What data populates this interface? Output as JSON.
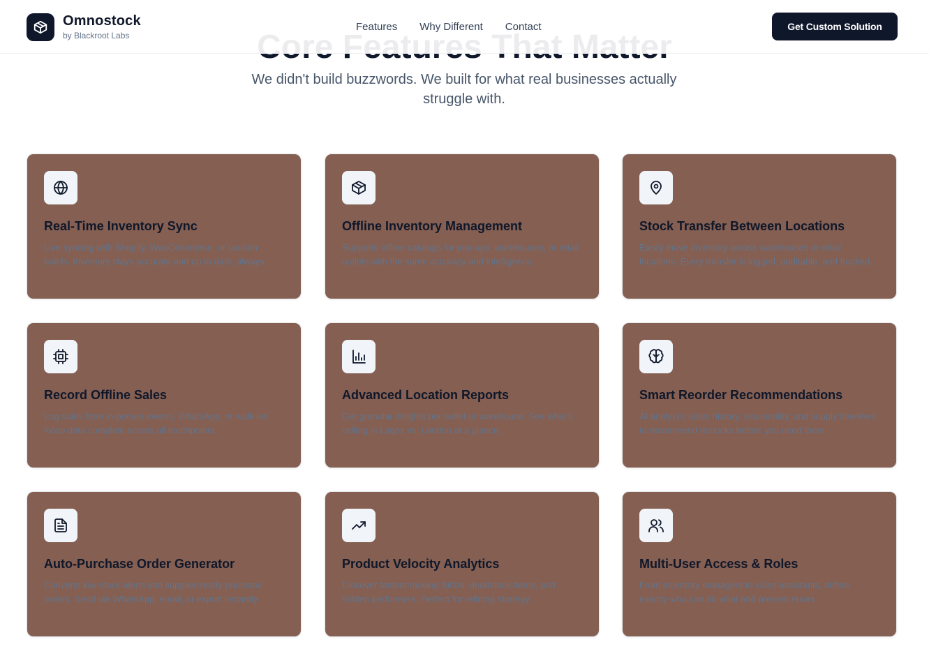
{
  "brand": {
    "name": "Omnostock",
    "sub": "by Blackroot Labs"
  },
  "nav": {
    "items": [
      "Features",
      "Why Different",
      "Contact"
    ]
  },
  "cta": {
    "label": "Get Custom Solution"
  },
  "hero": {
    "title": "Core Features That Matter",
    "subtitle": "We didn't build buzzwords. We built for what real businesses actually struggle with."
  },
  "features": [
    {
      "icon": "globe-icon",
      "title": "Real-Time Inventory Sync",
      "desc": "Live syncing with Shopify, WooCommerce, or custom builds. Inventory stays accurate and up to date, always."
    },
    {
      "icon": "package-icon",
      "title": "Offline Inventory Management",
      "desc": "Supports offline catalogs for pop-ups, warehouses, or retail outlets with the same accuracy and intelligence."
    },
    {
      "icon": "map-pin-icon",
      "title": "Stock Transfer Between Locations",
      "desc": "Easily move inventory across warehouses or retail locations. Every transfer is logged, auditable, and tracked."
    },
    {
      "icon": "cpu-icon",
      "title": "Record Offline Sales",
      "desc": "Log sales from in-person events, WhatsApp, or walk-ins. Keep data complete across all touchpoints."
    },
    {
      "icon": "bar-chart-icon",
      "title": "Advanced Location Reports",
      "desc": "Get granular insights per outlet or warehouse. See what's selling in Lagos vs. London at a glance."
    },
    {
      "icon": "brain-icon",
      "title": "Smart Reorder Recommendations",
      "desc": "AI analyzes sales history, seasonality, and supply timelines to recommend restocks before you need them."
    },
    {
      "icon": "document-icon",
      "title": "Auto-Purchase Order Generator",
      "desc": "Converts low-stock alerts into supplier-ready purchase orders. Send via WhatsApp, email, or export instantly."
    },
    {
      "icon": "trending-up-icon",
      "title": "Product Velocity Analytics",
      "desc": "Discover fastest-moving SKUs, deadstock items, and hidden performers. Perfect for refining strategy."
    },
    {
      "icon": "users-icon",
      "title": "Multi-User Access & Roles",
      "desc": "From inventory managers to sales assistants, define exactly who can do what and prevent errors."
    }
  ],
  "colors": {
    "card_bg": "#845f52",
    "dark": "#0f172a",
    "muted": "#64748b"
  }
}
